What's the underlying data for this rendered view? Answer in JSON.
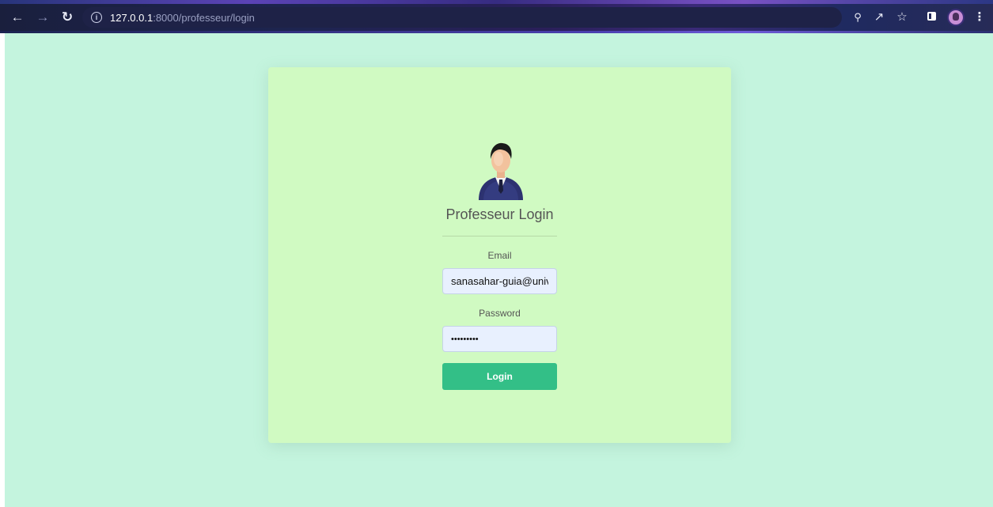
{
  "browser": {
    "url_host": "127.0.0.1",
    "url_rest": ":8000/professeur/login",
    "icons": [
      "back-arrow-icon",
      "forward-arrow-icon",
      "reload-icon",
      "info-icon",
      "key-icon",
      "share-icon",
      "star-icon",
      "side-panel-icon",
      "profile-avatar-icon",
      "menu-kebab-icon"
    ]
  },
  "login": {
    "title": "Professeur Login",
    "email_label": "Email",
    "email_value": "sanasahar-guia@univ-",
    "password_label": "Password",
    "password_value": "•••••••••",
    "button_label": "Login"
  },
  "colors": {
    "page_bg": "#c4f4de",
    "card_bg": "#d0fac2",
    "button_bg": "#33bf87",
    "input_bg": "#e8f0fe"
  }
}
